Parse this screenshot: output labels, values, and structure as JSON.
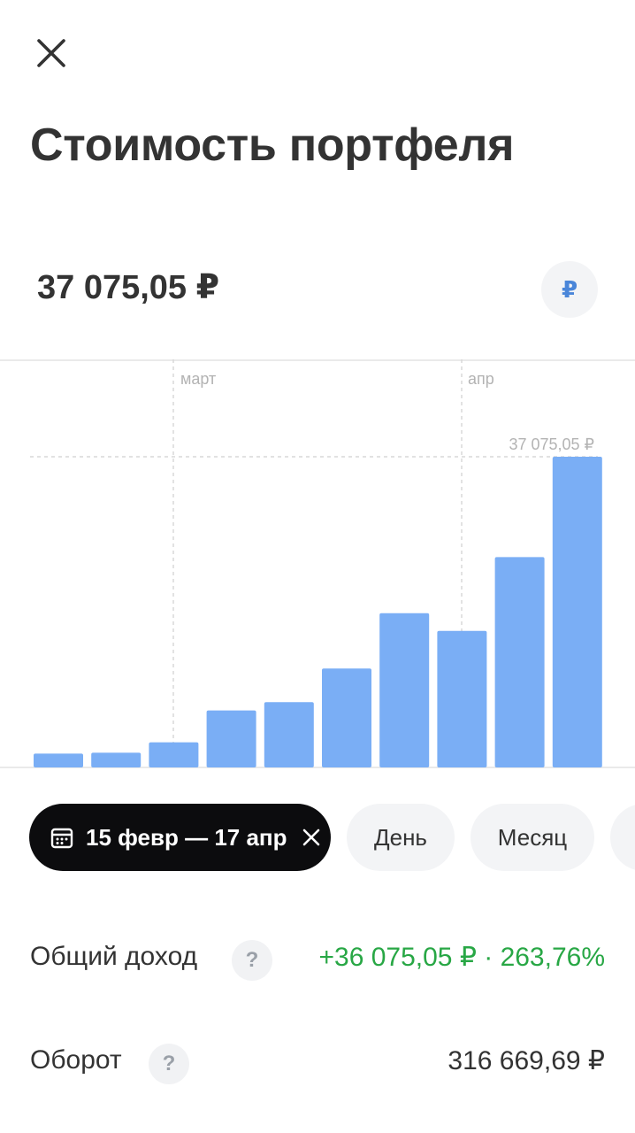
{
  "header": {
    "close_icon": "close-icon",
    "title": "Стоимость портфеля"
  },
  "portfolio": {
    "value": "37 075,05 ₽",
    "currency_symbol": "₽"
  },
  "chart_data": {
    "type": "bar",
    "x_markers": [
      "март",
      "апр"
    ],
    "max_label": "37 075,05 ₽",
    "values": [
      1650,
      1750,
      3000,
      6800,
      7800,
      11800,
      18400,
      16300,
      25100,
      37075.05
    ],
    "ylim": [
      0,
      37075.05
    ],
    "bar_color": "#7aaef5",
    "grid": true
  },
  "filters": {
    "range_label": "15 февр — 17 апр",
    "day_label": "День",
    "month_label": "Месяц"
  },
  "stats": {
    "income_label": "Общий доход",
    "income_value": "+36 075,05 ₽ · 263,76%",
    "income_color": "#28a745",
    "turnover_label": "Оборот",
    "turnover_value": "316 669,69 ₽",
    "help_symbol": "?"
  }
}
